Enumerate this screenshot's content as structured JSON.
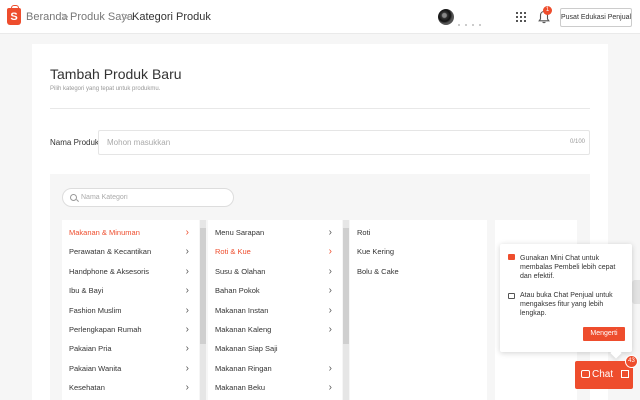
{
  "topbar": {
    "logo": "S",
    "breadcrumb": [
      "Beranda",
      "Produk Saya",
      "Kategori Produk"
    ],
    "separator": ">",
    "notification_count": "1",
    "edu_button": "Pusat Edukasi Penjual"
  },
  "page": {
    "title": "Tambah Produk Baru",
    "subtitle": "Pilih kategori yang tepat untuk produkmu.",
    "name_label": "Nama Produk:",
    "name_placeholder": "Mohon masukkan",
    "name_counter": "0/100",
    "category_search_placeholder": "Nama Kategori"
  },
  "categories": {
    "level1": [
      {
        "label": "Makanan & Minuman",
        "active": true
      },
      {
        "label": "Perawatan & Kecantikan"
      },
      {
        "label": "Handphone & Aksesoris"
      },
      {
        "label": "Ibu & Bayi"
      },
      {
        "label": "Fashion Muslim"
      },
      {
        "label": "Perlengkapan Rumah"
      },
      {
        "label": "Pakaian Pria"
      },
      {
        "label": "Pakaian Wanita"
      },
      {
        "label": "Kesehatan"
      }
    ],
    "level2": [
      {
        "label": "Menu Sarapan"
      },
      {
        "label": "Roti & Kue",
        "active": true
      },
      {
        "label": "Susu & Olahan"
      },
      {
        "label": "Bahan Pokok"
      },
      {
        "label": "Makanan Instan"
      },
      {
        "label": "Makanan Kaleng"
      },
      {
        "label": "Makanan Siap Saji"
      },
      {
        "label": "Makanan Ringan"
      },
      {
        "label": "Makanan Beku"
      }
    ],
    "level3": [
      {
        "label": "Roti"
      },
      {
        "label": "Kue Kering"
      },
      {
        "label": "Bolu & Cake"
      }
    ],
    "arrow": "›"
  },
  "chat_popup": {
    "text1": "Gunakan Mini Chat untuk membalas Pembeli lebih cepat dan efektif.",
    "text2": "Atau buka Chat Penjual untuk mengakses fitur yang lebih lengkap.",
    "button": "Mengerti"
  },
  "chat_button": {
    "label": "Chat",
    "count": "43"
  },
  "colors": {
    "accent": "#ee4d2d",
    "background": "#f6f6f6"
  }
}
